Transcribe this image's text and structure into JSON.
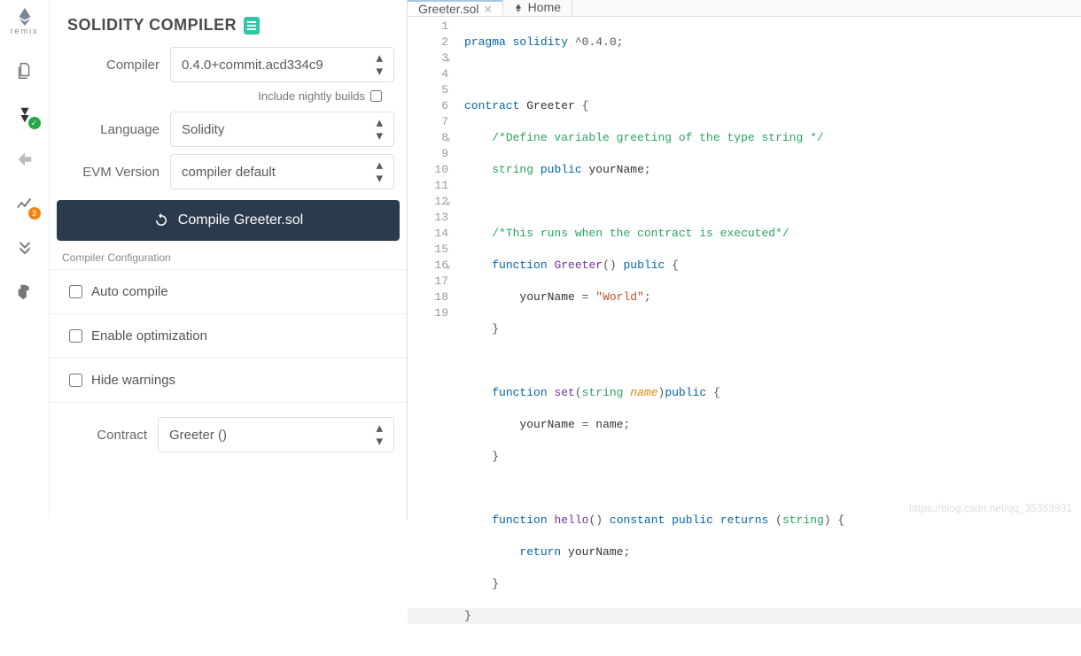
{
  "brand": {
    "name": "remix"
  },
  "iconbar": {
    "chart_badge": "3"
  },
  "panel": {
    "title": "SOLIDITY COMPILER",
    "compiler_label": "Compiler",
    "compiler_value": "0.4.0+commit.acd334c9",
    "nightly_label": "Include nightly builds",
    "language_label": "Language",
    "language_value": "Solidity",
    "evm_label": "EVM Version",
    "evm_value": "compiler default",
    "compile_button": "Compile Greeter.sol",
    "config_header": "Compiler Configuration",
    "auto_compile": "Auto compile",
    "enable_opt": "Enable optimization",
    "hide_warnings": "Hide warnings",
    "contract_label": "Contract",
    "contract_value": "Greeter ()"
  },
  "tabs": {
    "file": "Greeter.sol",
    "home": "Home",
    "home_sub": "remix"
  },
  "code": {
    "lines": [
      "pragma solidity ^0.4.0;",
      "",
      "contract Greeter {",
      "    /*Define variable greeting of the type string */",
      "    string public yourName;",
      "",
      "    /*This runs when the contract is executed*/",
      "    function Greeter() public {",
      "        yourName = \"World\";",
      "    }",
      "",
      "    function set(string name)public {",
      "        yourName = name;",
      "    }",
      "",
      "    function hello() constant public returns (string) {",
      "        return yourName;",
      "    }",
      "}"
    ]
  },
  "watermark": "https://blog.csdn.net/qq_35353931"
}
